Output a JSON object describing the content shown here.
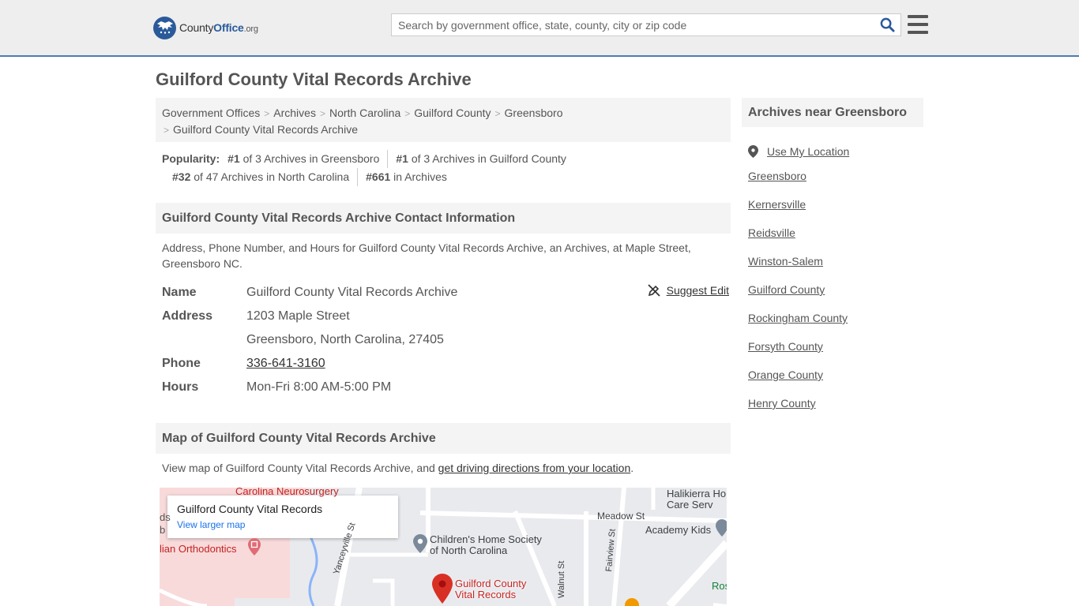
{
  "header": {
    "logo": {
      "prefix": "County",
      "brand": "Office",
      "tld": ".org"
    },
    "search": {
      "placeholder": "Search by government office, state, county, city or zip code",
      "value": ""
    }
  },
  "page_title": "Guilford County Vital Records Archive",
  "breadcrumb": {
    "items": [
      "Government Offices",
      "Archives",
      "North Carolina",
      "Guilford County",
      "Greensboro"
    ],
    "current": "Guilford County Vital Records Archive"
  },
  "popularity": {
    "label": "Popularity:",
    "items": [
      {
        "rank": "#1",
        "text": "of 3 Archives in Greensboro"
      },
      {
        "rank": "#1",
        "text": "of 3 Archives in Guilford County"
      },
      {
        "rank": "#32",
        "text": "of 47 Archives in North Carolina"
      },
      {
        "rank": "#661",
        "text": "in Archives"
      }
    ]
  },
  "contact_section": {
    "heading": "Guilford County Vital Records Archive Contact Information",
    "description": "Address, Phone Number, and Hours for Guilford County Vital Records Archive, an Archives, at Maple Street, Greensboro NC.",
    "suggest_edit": "Suggest Edit",
    "labels": {
      "name": "Name",
      "address": "Address",
      "phone": "Phone",
      "hours": "Hours"
    },
    "name": "Guilford County Vital Records Archive",
    "address_line1": "1203 Maple Street",
    "address_line2": "Greensboro, North Carolina, 27405",
    "phone": "336-641-3160",
    "hours": "Mon-Fri 8:00 AM-5:00 PM"
  },
  "map_section": {
    "heading": "Map of Guilford County Vital Records Archive",
    "desc_prefix": "View map of Guilford County Vital Records Archive, and ",
    "desc_link": "get driving directions from your location",
    "desc_suffix": ".",
    "card_title": "Guilford County Vital Records",
    "card_link": "View larger map",
    "labels": {
      "carolina_neuro": "Carolina Neurosurgery",
      "orthodontics": "lian Orthodontics",
      "ds": "ds",
      "b": "b",
      "childrens_home": "Children's Home Society",
      "childrens_home2": "of North Carolina",
      "pin_line1": "Guilford County",
      "pin_line2": "Vital Records",
      "meadow": "Meadow St",
      "academy": "Academy Kids",
      "halikierra": "Halikierra Ho",
      "care": "Care Serv",
      "yanceyville": "Yanceyville St",
      "walnut": "Walnut St",
      "fairview": "Fairview St",
      "ros": "Ros"
    }
  },
  "sidebar": {
    "heading": "Archives near Greensboro",
    "use_location": "Use My Location",
    "links": [
      "Greensboro",
      "Kernersville",
      "Reidsville",
      "Winston-Salem",
      "Guilford County",
      "Rockingham County",
      "Forsyth County",
      "Orange County",
      "Henry County"
    ]
  },
  "colors": {
    "brand": "#2a5a9a",
    "header_bg": "#eeeeee",
    "header_border": "#4b7bb8",
    "panel_bg": "#f4f4f4",
    "pin": "#d93025"
  }
}
